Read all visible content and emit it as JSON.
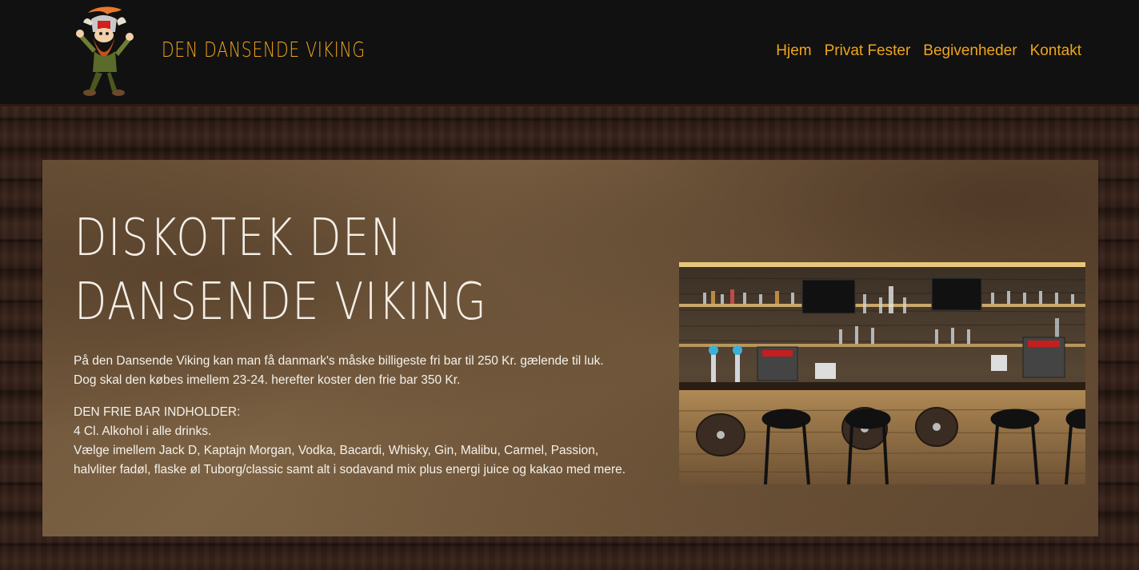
{
  "header": {
    "brand": "DEN DANSENDE VIKING",
    "nav": [
      {
        "label": "Hjem"
      },
      {
        "label": "Privat Fester"
      },
      {
        "label": "Begivenheder"
      },
      {
        "label": "Kontakt"
      }
    ]
  },
  "main": {
    "title": "DISKOTEK DEN DANSENDE VIKING",
    "intro_line1": "På den Dansende Viking kan man få danmark's måske billigeste fri bar til 250 Kr. gælende til luk.",
    "intro_line2": "Dog skal den købes imellem 23-24. herefter koster den frie bar 350 Kr.",
    "bar_heading": "DEN FRIE BAR INDHOLDER:",
    "bar_line1": "4 Cl. Alkohol i alle drinks.",
    "bar_line2": "Vælge imellem Jack D, Kaptajn Morgan, Vodka, Bacardi, Whisky, Gin, Malibu, Carmel, Passion,",
    "bar_line3": "halvliter fadøl, flaske øl Tuborg/classic samt alt i sodavand mix plus energi juice og kakao med mere."
  },
  "colors": {
    "accent": "#f0a51c",
    "header_bg": "#111111",
    "panel_bg": "#735a3e"
  },
  "icons": {
    "logo": "dancing-viking-logo",
    "photo": "bar-interior-photo"
  }
}
